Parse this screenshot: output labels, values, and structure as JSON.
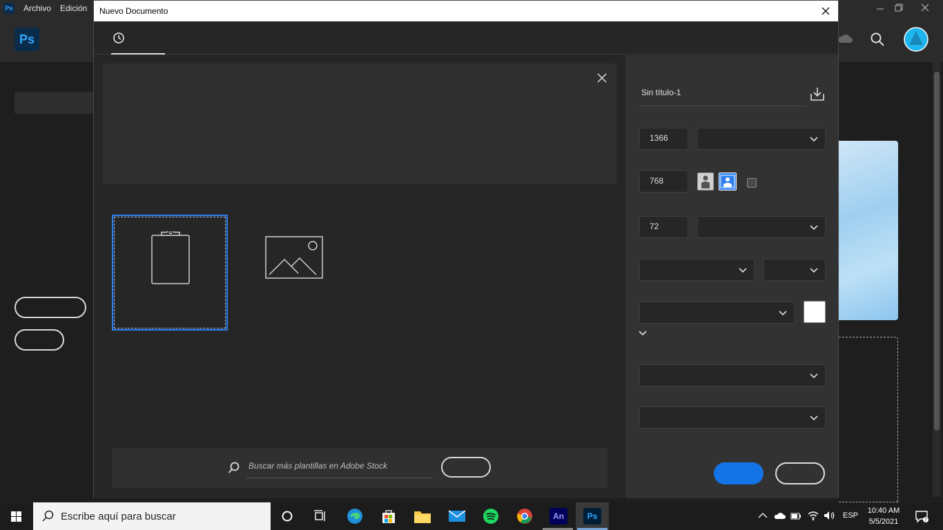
{
  "app": {
    "menu": [
      "Archivo",
      "Edición"
    ],
    "logo_text": "Ps",
    "mini_logo_text": "Ps"
  },
  "dialog": {
    "title": "Nuevo Documento",
    "stock_search_placeholder": "Buscar más plantillas en Adobe Stock",
    "preset": {
      "name": "Sin título-1",
      "width": "1366",
      "height": "768",
      "resolution": "72"
    },
    "colors": {
      "accent": "#1473e6",
      "selection": "#2d7ff0",
      "background_swatch": "#ffffff"
    }
  },
  "taskbar": {
    "search_placeholder": "Escribe aquí para buscar",
    "apps": [
      "task-view",
      "edge",
      "store",
      "file-explorer",
      "mail",
      "spotify",
      "chrome",
      "animate",
      "photoshop"
    ],
    "animate_label": "An",
    "photoshop_label": "Ps",
    "language": "ESP",
    "time": "10:40 AM",
    "date": "5/5/2021"
  }
}
